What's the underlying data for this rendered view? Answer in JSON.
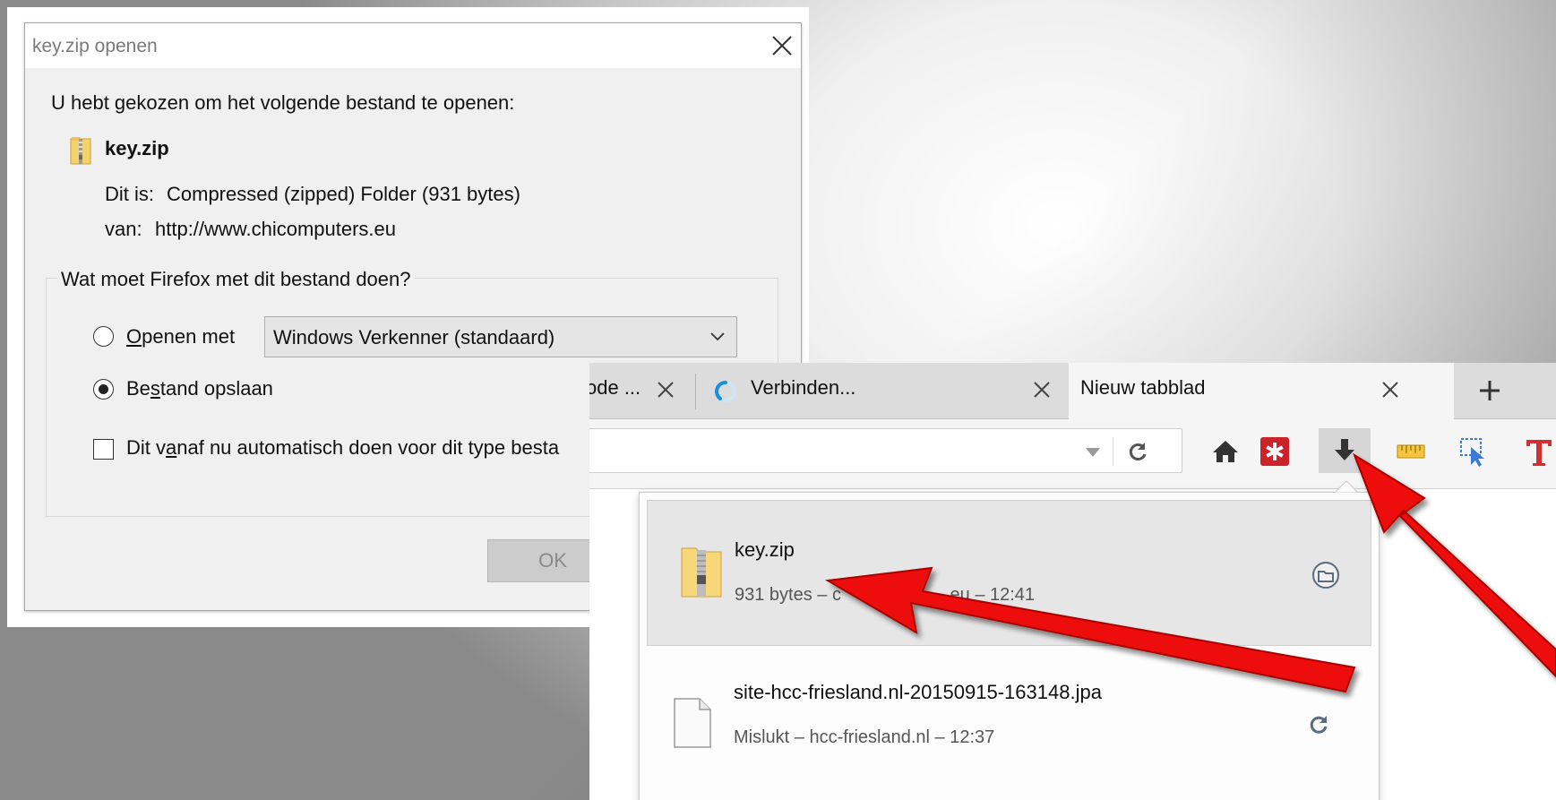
{
  "dialog": {
    "title": "key.zip openen",
    "intro": "U hebt gekozen om het volgende bestand te openen:",
    "filename": "key.zip",
    "type_label": "Dit is:",
    "type_value": "Compressed (zipped) Folder (931 bytes)",
    "from_label": "van:",
    "from_value": "http://www.chicomputers.eu",
    "question": "Wat moet Firefox met dit bestand doen?",
    "open_with_label_first": "O",
    "open_with_label_rest": "penen met",
    "open_with_app": "Windows Verkenner (standaard)",
    "save_label_a": "Be",
    "save_label_u": "s",
    "save_label_b": "tand opslaan",
    "selected_option": "save",
    "auto_label_a": "Dit v",
    "auto_label_u": "a",
    "auto_label_b": "naf nu automatisch doen voor dit type besta",
    "auto_checked": false,
    "ok_label": "OK"
  },
  "browser": {
    "tabs": [
      {
        "title": "ode ...",
        "loading": false
      },
      {
        "title": "Verbinden...",
        "loading": true
      },
      {
        "title": "Nieuw tabblad",
        "active": true
      }
    ],
    "new_tab_symbol": "+",
    "toolbar_icons": [
      "home-icon",
      "lastpass-icon",
      "download-icon",
      "ruler-icon",
      "picker-icon",
      "text-icon"
    ],
    "downloads": [
      {
        "name": "key.zip",
        "meta_prefix": "931 bytes – c",
        "meta_suffix": ".eu – 12:41",
        "action": "open-folder"
      },
      {
        "name": "site-hcc-friesland.nl-20150915-163148.jpa",
        "meta": "Mislukt – hcc-friesland.nl – 12:37",
        "action": "retry"
      }
    ]
  },
  "colors": {
    "arrow": "#ee1111",
    "spinner": "#1a8fe0",
    "lastpass": "#cc2229"
  }
}
